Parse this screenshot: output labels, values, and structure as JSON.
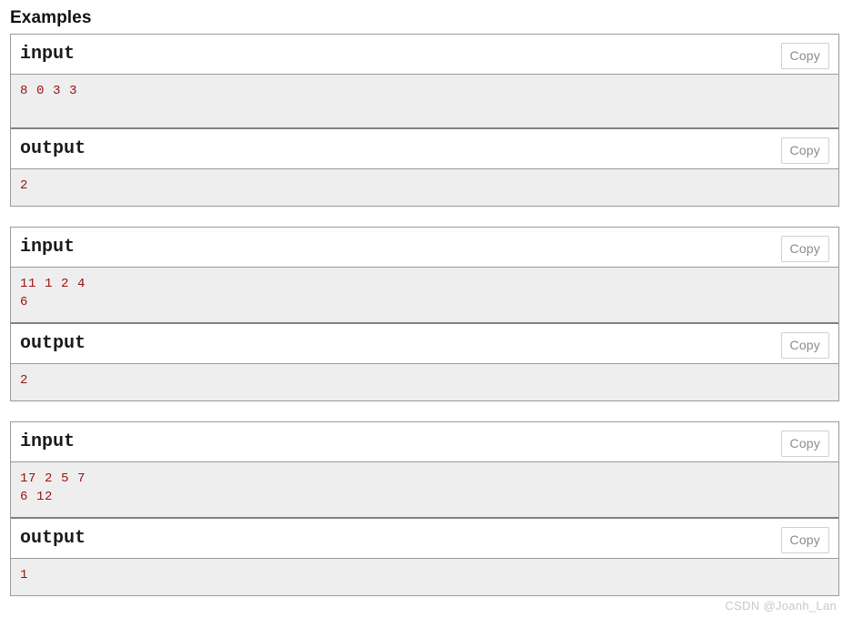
{
  "section": {
    "title": "Examples"
  },
  "labels": {
    "input": "input",
    "output": "output",
    "copy": "Copy"
  },
  "colors": {
    "data_text": "#9b1010",
    "data_background": "#eeeeee",
    "block_border": "#9a9a9a",
    "separator": "#808080",
    "copy_text": "#8c8c8c",
    "copy_border": "#d0d0d0",
    "watermark": "#c9c9c9"
  },
  "examples": [
    {
      "input_label": "input",
      "input_copy_label": "Copy",
      "input_data": "8 0 3 3",
      "output_label": "output",
      "output_copy_label": "Copy",
      "output_data": "2"
    },
    {
      "input_label": "input",
      "input_copy_label": "Copy",
      "input_data": "11 1 2 4\n6",
      "output_label": "output",
      "output_copy_label": "Copy",
      "output_data": "2"
    },
    {
      "input_label": "input",
      "input_copy_label": "Copy",
      "input_data": "17 2 5 7\n6 12",
      "output_label": "output",
      "output_copy_label": "Copy",
      "output_data": "1"
    }
  ],
  "watermark": {
    "text": "CSDN @Joanh_Lan"
  }
}
